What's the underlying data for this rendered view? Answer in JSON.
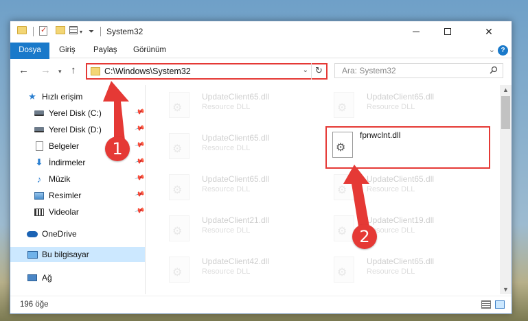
{
  "window": {
    "title": "System32",
    "min_glyph": "",
    "max_glyph": "",
    "close_glyph": "✕"
  },
  "ribbon": {
    "tabs": [
      "Dosya",
      "Giriş",
      "Paylaş",
      "Görünüm"
    ],
    "help": "?"
  },
  "address": {
    "path": "C:\\Windows\\System32",
    "dropdown": "⌄",
    "refresh": "↻"
  },
  "search": {
    "placeholder": "Ara: System32"
  },
  "sidebar": {
    "items": [
      {
        "label": "Hızlı erişim",
        "icon": "star-icon",
        "pinned": false
      },
      {
        "label": "Yerel Disk (C:)",
        "icon": "drive-icon",
        "pinned": true
      },
      {
        "label": "Yerel Disk (D:)",
        "icon": "drive-icon",
        "pinned": true
      },
      {
        "label": "Belgeler",
        "icon": "document-icon",
        "pinned": true
      },
      {
        "label": "İndirmeler",
        "icon": "download-icon",
        "pinned": true
      },
      {
        "label": "Müzik",
        "icon": "music-icon",
        "pinned": true
      },
      {
        "label": "Resimler",
        "icon": "pictures-icon",
        "pinned": true
      },
      {
        "label": "Videolar",
        "icon": "videos-icon",
        "pinned": true
      },
      {
        "label": "OneDrive",
        "icon": "cloud-icon",
        "pinned": false
      },
      {
        "label": "Bu bilgisayar",
        "icon": "computer-icon",
        "pinned": false,
        "selected": true
      },
      {
        "label": "Ağ",
        "icon": "network-icon",
        "pinned": false
      }
    ]
  },
  "files": {
    "left": [
      {
        "name": "UpdateClient65.dll",
        "desc": "Resource DLL"
      },
      {
        "name": "UpdateClient65.dll",
        "desc": "Resource DLL"
      },
      {
        "name": "UpdateClient65.dll",
        "desc": "Resource DLL"
      },
      {
        "name": "UpdateClient21.dll",
        "desc": "Resource DLL"
      },
      {
        "name": "UpdateClient42.dll",
        "desc": "Resource DLL"
      }
    ],
    "right": [
      {
        "name": "UpdateClient65.dll",
        "desc": "Resource DLL"
      },
      {
        "name": "fpnwclnt.dll",
        "desc": ""
      },
      {
        "name": "UpdateClient65.dll",
        "desc": "Resource DLL"
      },
      {
        "name": "UpdateClient19.dll",
        "desc": "Resource DLL"
      },
      {
        "name": "UpdateClient65.dll",
        "desc": "Resource DLL"
      }
    ]
  },
  "status": {
    "count": "196 öğe"
  },
  "annotations": {
    "badge1": "1",
    "badge2": "2",
    "color": "#e53935"
  }
}
